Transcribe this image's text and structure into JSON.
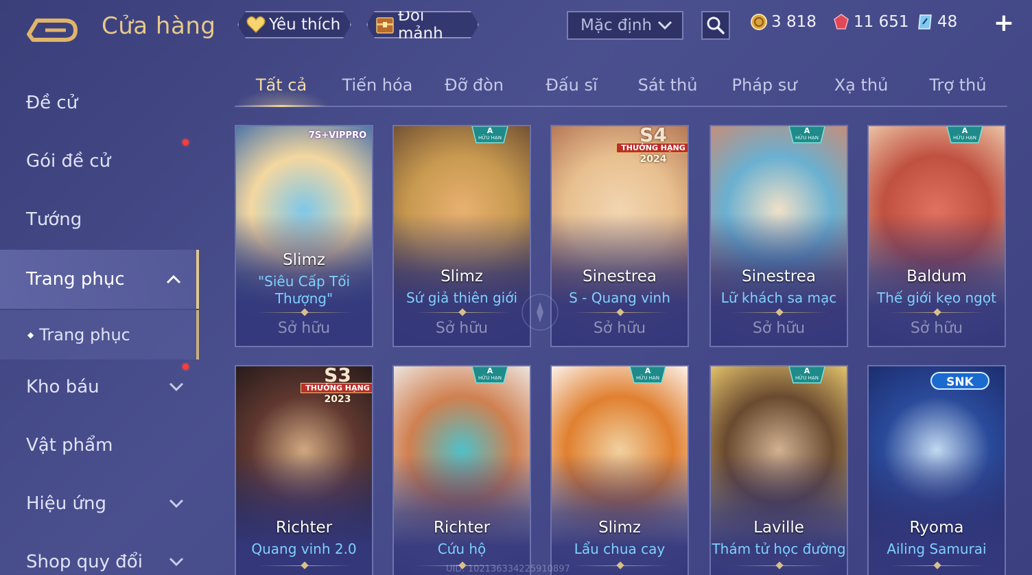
{
  "header": {
    "title": "Cửa hàng",
    "favorites_label": "Yêu thích",
    "exchange_label": "Đổi mảnh",
    "sort": {
      "selected": "Mặc định"
    },
    "currencies": [
      {
        "name": "gold-coin-icon",
        "value": "3 818"
      },
      {
        "name": "ruby-gem-icon",
        "value": "11 651"
      },
      {
        "name": "voucher-icon",
        "value": "48"
      }
    ]
  },
  "sidebar": {
    "items": [
      {
        "label": "Đề cử"
      },
      {
        "label": "Gói đề cử"
      },
      {
        "label": "Tướng"
      },
      {
        "label": "Trang phục"
      },
      {
        "label": "Trang phục"
      },
      {
        "label": "Kho báu"
      },
      {
        "label": "Vật phẩm"
      },
      {
        "label": "Hiệu ứng"
      },
      {
        "label": "Shop quy đổi"
      }
    ]
  },
  "tabs": [
    {
      "label": "Tất cả"
    },
    {
      "label": "Tiến hóa"
    },
    {
      "label": "Đỡ đòn"
    },
    {
      "label": "Đấu sĩ"
    },
    {
      "label": "Sát thủ"
    },
    {
      "label": "Pháp sư"
    },
    {
      "label": "Xạ thủ"
    },
    {
      "label": "Trợ thủ"
    }
  ],
  "cards": [
    {
      "hero": "Slimz",
      "skin": "\"Siêu Cấp Tối Thượng\"",
      "status": "Sở hữu",
      "badge": "7S+VIPPRO",
      "art": [
        "#7ec7e8",
        "#f4d7a0",
        "#3a6aa8"
      ]
    },
    {
      "hero": "Slimz",
      "skin": "Sứ giả thiên giới",
      "status": "Sở hữu",
      "badge": "A",
      "badge_sub": "HỮU HẠN",
      "art": [
        "#e8b070",
        "#c89a50",
        "#6a4a30"
      ]
    },
    {
      "hero": "Sinestrea",
      "skin": "S - Quang vinh",
      "status": "Sở hữu",
      "badge": "S4",
      "badge_sub": "THƯỞNG HẠNG",
      "badge_year": "2024",
      "art": [
        "#f2d5b0",
        "#e8c090",
        "#b07050"
      ]
    },
    {
      "hero": "Sinestrea",
      "skin": "Lữ khách sa mạc",
      "status": "Sở hữu",
      "badge": "A",
      "badge_sub": "HỮU HẠN",
      "art": [
        "#f0e0c8",
        "#6ab0d0",
        "#d08a70"
      ]
    },
    {
      "hero": "Baldum",
      "skin": "Thế giới kẹo ngọt",
      "status": "Sở hữu",
      "badge": "A",
      "badge_sub": "HỮU HẠN",
      "art": [
        "#e07060",
        "#c05040",
        "#f0d0b0"
      ]
    },
    {
      "hero": "Richter",
      "skin": "Quang vinh 2.0",
      "status": "",
      "badge": "S3",
      "badge_sub": "THƯỞNG HẠNG",
      "badge_year": "2023",
      "art": [
        "#d0a880",
        "#603830",
        "#201818"
      ]
    },
    {
      "hero": "Richter",
      "skin": "Cứu hộ",
      "status": "",
      "badge": "A",
      "badge_sub": "HỮU HẠN",
      "art": [
        "#50c0c8",
        "#d08050",
        "#f0f0f0"
      ]
    },
    {
      "hero": "Slimz",
      "skin": "Lẩu chua cay",
      "status": "",
      "badge": "A",
      "badge_sub": "HỮU HẠN",
      "art": [
        "#f0d0a0",
        "#e08030",
        "#ffffff"
      ]
    },
    {
      "hero": "Laville",
      "skin": "Thám tử học đường",
      "status": "",
      "badge": "A",
      "badge_sub": "HỮU HẠN",
      "art": [
        "#d0b090",
        "#6a4a30",
        "#f0d070"
      ]
    },
    {
      "hero": "Ryoma",
      "skin": "Ailing Samurai",
      "status": "",
      "badge": "SNK",
      "art": [
        "#c0d8f0",
        "#2a4a9a",
        "#1a2a6a"
      ]
    }
  ],
  "footer": {
    "uid": "UID: 102136334225910897"
  },
  "colors": {
    "accent_gold": "#e8c98a",
    "skin_name_blue": "#7fd0ff",
    "notification_red": "#ff3b3b"
  }
}
